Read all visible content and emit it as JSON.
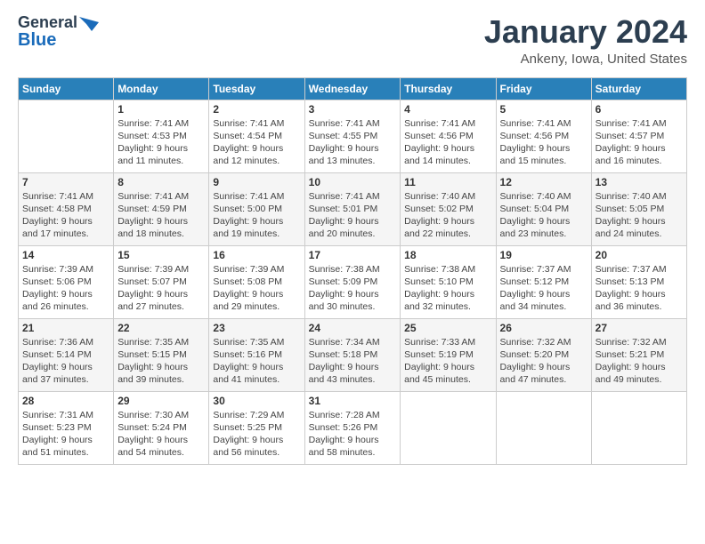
{
  "header": {
    "logo_line1": "General",
    "logo_line2": "Blue",
    "month": "January 2024",
    "location": "Ankeny, Iowa, United States"
  },
  "weekdays": [
    "Sunday",
    "Monday",
    "Tuesday",
    "Wednesday",
    "Thursday",
    "Friday",
    "Saturday"
  ],
  "weeks": [
    [
      {
        "day": "",
        "info": ""
      },
      {
        "day": "1",
        "info": "Sunrise: 7:41 AM\nSunset: 4:53 PM\nDaylight: 9 hours\nand 11 minutes."
      },
      {
        "day": "2",
        "info": "Sunrise: 7:41 AM\nSunset: 4:54 PM\nDaylight: 9 hours\nand 12 minutes."
      },
      {
        "day": "3",
        "info": "Sunrise: 7:41 AM\nSunset: 4:55 PM\nDaylight: 9 hours\nand 13 minutes."
      },
      {
        "day": "4",
        "info": "Sunrise: 7:41 AM\nSunset: 4:56 PM\nDaylight: 9 hours\nand 14 minutes."
      },
      {
        "day": "5",
        "info": "Sunrise: 7:41 AM\nSunset: 4:56 PM\nDaylight: 9 hours\nand 15 minutes."
      },
      {
        "day": "6",
        "info": "Sunrise: 7:41 AM\nSunset: 4:57 PM\nDaylight: 9 hours\nand 16 minutes."
      }
    ],
    [
      {
        "day": "7",
        "info": "Sunrise: 7:41 AM\nSunset: 4:58 PM\nDaylight: 9 hours\nand 17 minutes."
      },
      {
        "day": "8",
        "info": "Sunrise: 7:41 AM\nSunset: 4:59 PM\nDaylight: 9 hours\nand 18 minutes."
      },
      {
        "day": "9",
        "info": "Sunrise: 7:41 AM\nSunset: 5:00 PM\nDaylight: 9 hours\nand 19 minutes."
      },
      {
        "day": "10",
        "info": "Sunrise: 7:41 AM\nSunset: 5:01 PM\nDaylight: 9 hours\nand 20 minutes."
      },
      {
        "day": "11",
        "info": "Sunrise: 7:40 AM\nSunset: 5:02 PM\nDaylight: 9 hours\nand 22 minutes."
      },
      {
        "day": "12",
        "info": "Sunrise: 7:40 AM\nSunset: 5:04 PM\nDaylight: 9 hours\nand 23 minutes."
      },
      {
        "day": "13",
        "info": "Sunrise: 7:40 AM\nSunset: 5:05 PM\nDaylight: 9 hours\nand 24 minutes."
      }
    ],
    [
      {
        "day": "14",
        "info": "Sunrise: 7:39 AM\nSunset: 5:06 PM\nDaylight: 9 hours\nand 26 minutes."
      },
      {
        "day": "15",
        "info": "Sunrise: 7:39 AM\nSunset: 5:07 PM\nDaylight: 9 hours\nand 27 minutes."
      },
      {
        "day": "16",
        "info": "Sunrise: 7:39 AM\nSunset: 5:08 PM\nDaylight: 9 hours\nand 29 minutes."
      },
      {
        "day": "17",
        "info": "Sunrise: 7:38 AM\nSunset: 5:09 PM\nDaylight: 9 hours\nand 30 minutes."
      },
      {
        "day": "18",
        "info": "Sunrise: 7:38 AM\nSunset: 5:10 PM\nDaylight: 9 hours\nand 32 minutes."
      },
      {
        "day": "19",
        "info": "Sunrise: 7:37 AM\nSunset: 5:12 PM\nDaylight: 9 hours\nand 34 minutes."
      },
      {
        "day": "20",
        "info": "Sunrise: 7:37 AM\nSunset: 5:13 PM\nDaylight: 9 hours\nand 36 minutes."
      }
    ],
    [
      {
        "day": "21",
        "info": "Sunrise: 7:36 AM\nSunset: 5:14 PM\nDaylight: 9 hours\nand 37 minutes."
      },
      {
        "day": "22",
        "info": "Sunrise: 7:35 AM\nSunset: 5:15 PM\nDaylight: 9 hours\nand 39 minutes."
      },
      {
        "day": "23",
        "info": "Sunrise: 7:35 AM\nSunset: 5:16 PM\nDaylight: 9 hours\nand 41 minutes."
      },
      {
        "day": "24",
        "info": "Sunrise: 7:34 AM\nSunset: 5:18 PM\nDaylight: 9 hours\nand 43 minutes."
      },
      {
        "day": "25",
        "info": "Sunrise: 7:33 AM\nSunset: 5:19 PM\nDaylight: 9 hours\nand 45 minutes."
      },
      {
        "day": "26",
        "info": "Sunrise: 7:32 AM\nSunset: 5:20 PM\nDaylight: 9 hours\nand 47 minutes."
      },
      {
        "day": "27",
        "info": "Sunrise: 7:32 AM\nSunset: 5:21 PM\nDaylight: 9 hours\nand 49 minutes."
      }
    ],
    [
      {
        "day": "28",
        "info": "Sunrise: 7:31 AM\nSunset: 5:23 PM\nDaylight: 9 hours\nand 51 minutes."
      },
      {
        "day": "29",
        "info": "Sunrise: 7:30 AM\nSunset: 5:24 PM\nDaylight: 9 hours\nand 54 minutes."
      },
      {
        "day": "30",
        "info": "Sunrise: 7:29 AM\nSunset: 5:25 PM\nDaylight: 9 hours\nand 56 minutes."
      },
      {
        "day": "31",
        "info": "Sunrise: 7:28 AM\nSunset: 5:26 PM\nDaylight: 9 hours\nand 58 minutes."
      },
      {
        "day": "",
        "info": ""
      },
      {
        "day": "",
        "info": ""
      },
      {
        "day": "",
        "info": ""
      }
    ]
  ]
}
